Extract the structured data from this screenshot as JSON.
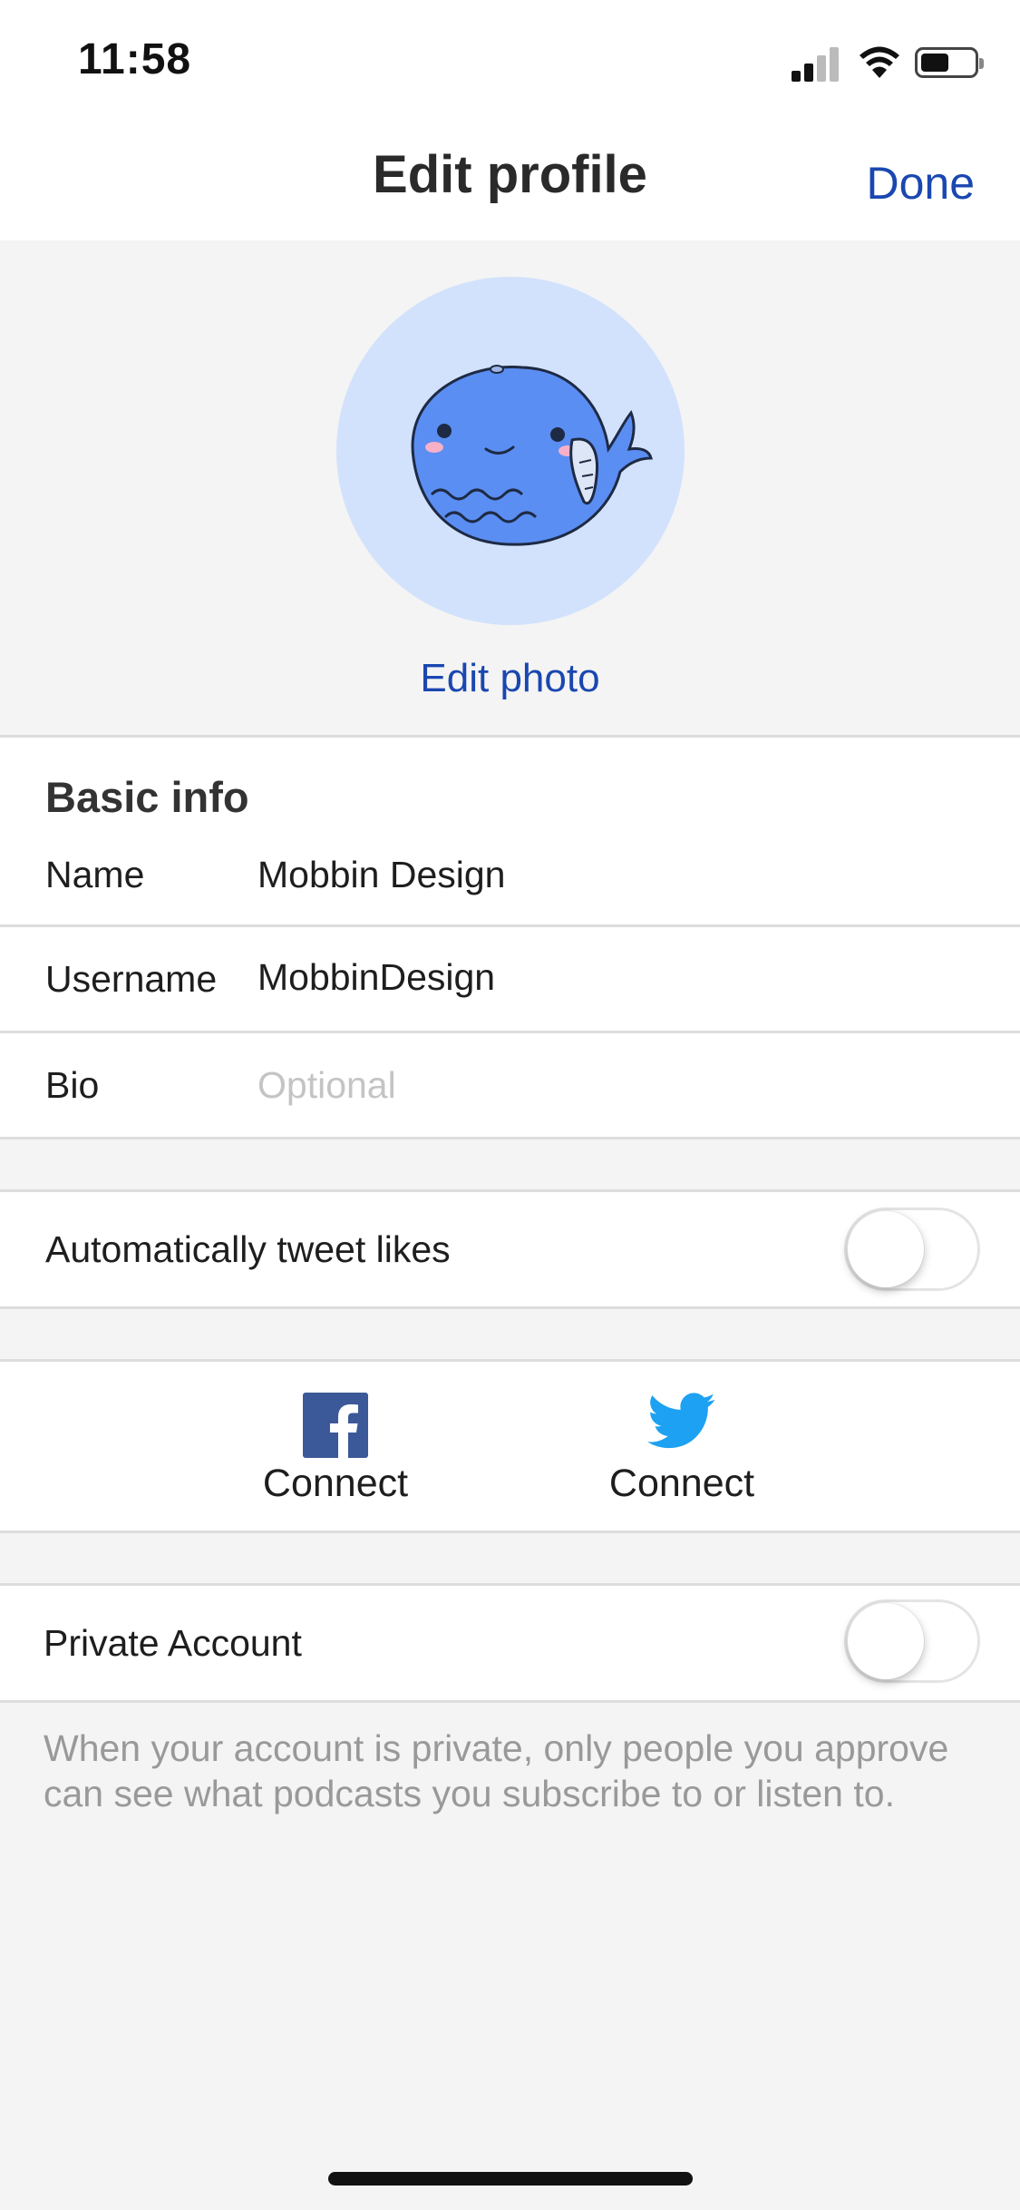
{
  "status_bar": {
    "time": "11:58",
    "icons": [
      "cellular-signal-icon",
      "wifi-icon",
      "battery-icon"
    ]
  },
  "nav": {
    "title": "Edit profile",
    "done_label": "Done"
  },
  "photo": {
    "avatar_icon": "whale-avatar-icon",
    "edit_label": "Edit photo"
  },
  "basic_info": {
    "title": "Basic info",
    "fields": [
      {
        "label": "Name",
        "value": "Mobbin Design",
        "placeholder": ""
      },
      {
        "label": "Username",
        "value": "MobbinDesign",
        "placeholder": ""
      },
      {
        "label": "Bio",
        "value": "",
        "placeholder": "Optional"
      }
    ]
  },
  "auto_tweet": {
    "label": "Automatically tweet likes",
    "enabled": false
  },
  "connect": [
    {
      "service_icon": "facebook-icon",
      "label": "Connect"
    },
    {
      "service_icon": "twitter-icon",
      "label": "Connect"
    }
  ],
  "private_account": {
    "label": "Private Account",
    "enabled": false,
    "note": "When your account is private, only people you approve can see what podcasts you subscribe to or listen to."
  },
  "colors": {
    "accent": "#1a47b0",
    "facebook": "#3b5998",
    "twitter": "#1da1f2",
    "avatar_bg": "#d2e2fc",
    "background": "#f4f4f4"
  }
}
